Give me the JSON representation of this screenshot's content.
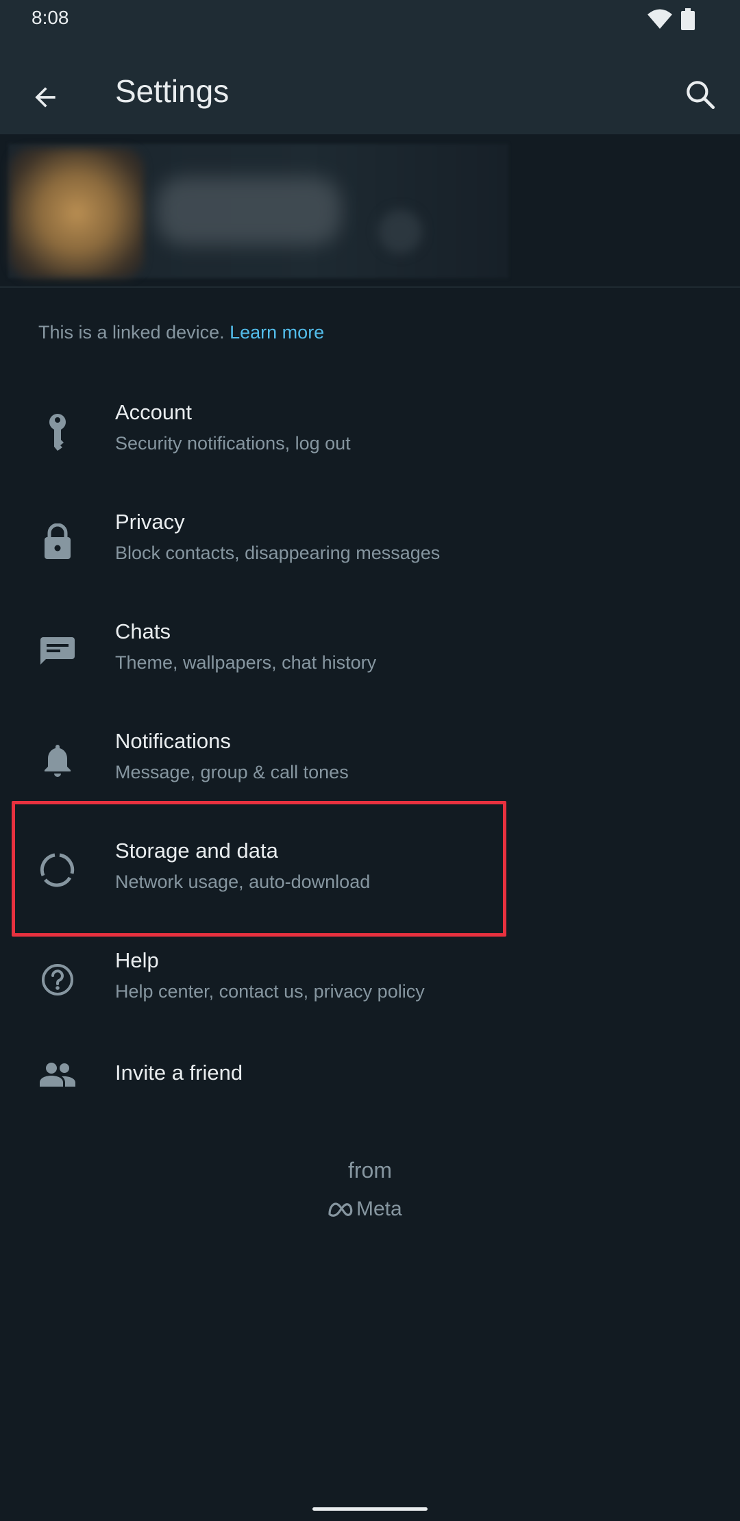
{
  "status_bar": {
    "time": "8:08"
  },
  "app_bar": {
    "title": "Settings"
  },
  "linked_note": {
    "text": "This is a linked device. ",
    "link": "Learn more"
  },
  "settings": [
    {
      "title": "Account",
      "subtitle": "Security notifications, log out",
      "icon": "key-icon"
    },
    {
      "title": "Privacy",
      "subtitle": "Block contacts, disappearing messages",
      "icon": "lock-icon"
    },
    {
      "title": "Chats",
      "subtitle": "Theme, wallpapers, chat history",
      "icon": "chat-icon"
    },
    {
      "title": "Notifications",
      "subtitle": "Message, group & call tones",
      "icon": "bell-icon"
    },
    {
      "title": "Storage and data",
      "subtitle": "Network usage, auto-download",
      "icon": "data-usage-icon"
    },
    {
      "title": "Help",
      "subtitle": "Help center, contact us, privacy policy",
      "icon": "help-icon"
    },
    {
      "title": "Invite a friend",
      "icon": "people-icon"
    }
  ],
  "footer": {
    "from": "from",
    "brand": "Meta"
  },
  "colors": {
    "background": "#121b22",
    "app_bar": "#1f2c34",
    "primary_text": "#e9edef",
    "secondary_text": "#8696a0",
    "link": "#53bdeb",
    "highlight": "#e8313f"
  }
}
